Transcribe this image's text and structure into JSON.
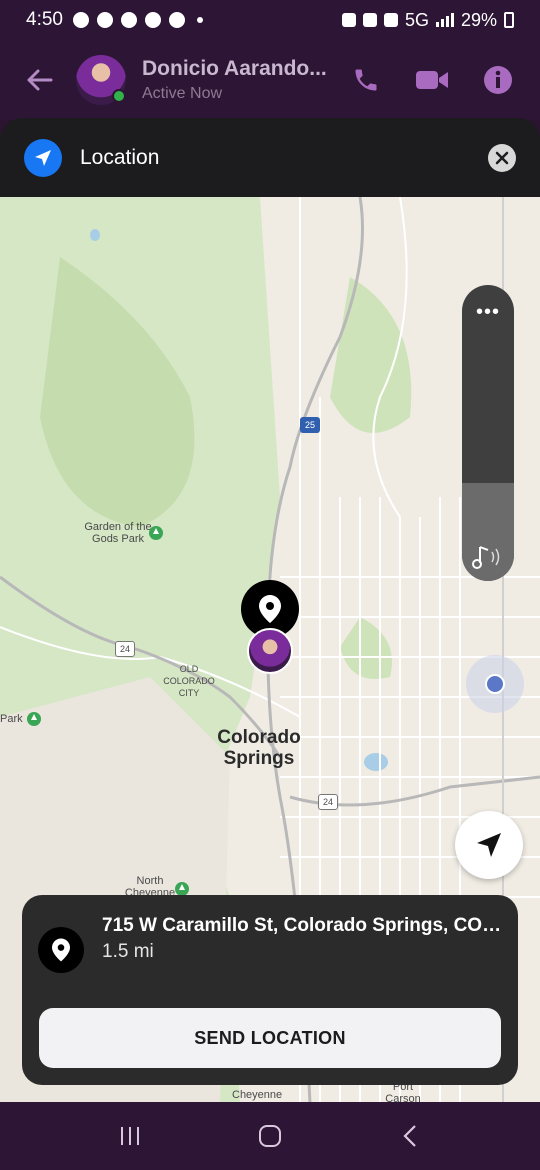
{
  "status_bar": {
    "time": "4:50",
    "network": "5G",
    "battery": "29%",
    "icons": [
      "facebook-icon",
      "chrome-icon",
      "chrome-icon",
      "chrome-icon",
      "chrome-icon",
      "dot-icon",
      "alarm-icon",
      "mute-icon",
      "location-icon",
      "signal-icon",
      "battery-icon"
    ]
  },
  "header": {
    "contact_name": "Donicio Aarando...",
    "contact_status": "Active Now",
    "icons": [
      "back-arrow-icon",
      "phone-icon",
      "video-icon",
      "info-icon"
    ]
  },
  "location_bar": {
    "title": "Location",
    "icons": [
      "location-arrow-icon",
      "close-icon"
    ]
  },
  "map": {
    "labels": {
      "garden": "Garden of the Gods Park",
      "old_city": "OLD COLORADO CITY",
      "city": "Colorado Springs",
      "park": "Park",
      "north_cheyenne": "North Cheyenne",
      "cheyenne": "Cheyenne",
      "port_carson": "Port Carson",
      "highway_25": "25",
      "highway_24a": "24",
      "highway_24b": "24"
    },
    "media_menu": "•••"
  },
  "card": {
    "address": "715 W Caramillo St, Colorado Springs, CO 8...",
    "distance": "1.5 mi",
    "send_label": "SEND LOCATION"
  },
  "colors": {
    "header_bg": "#2d1535",
    "accent_blue": "#1877f2",
    "card_bg": "#2b2b2b",
    "online_green": "#31b34a"
  }
}
